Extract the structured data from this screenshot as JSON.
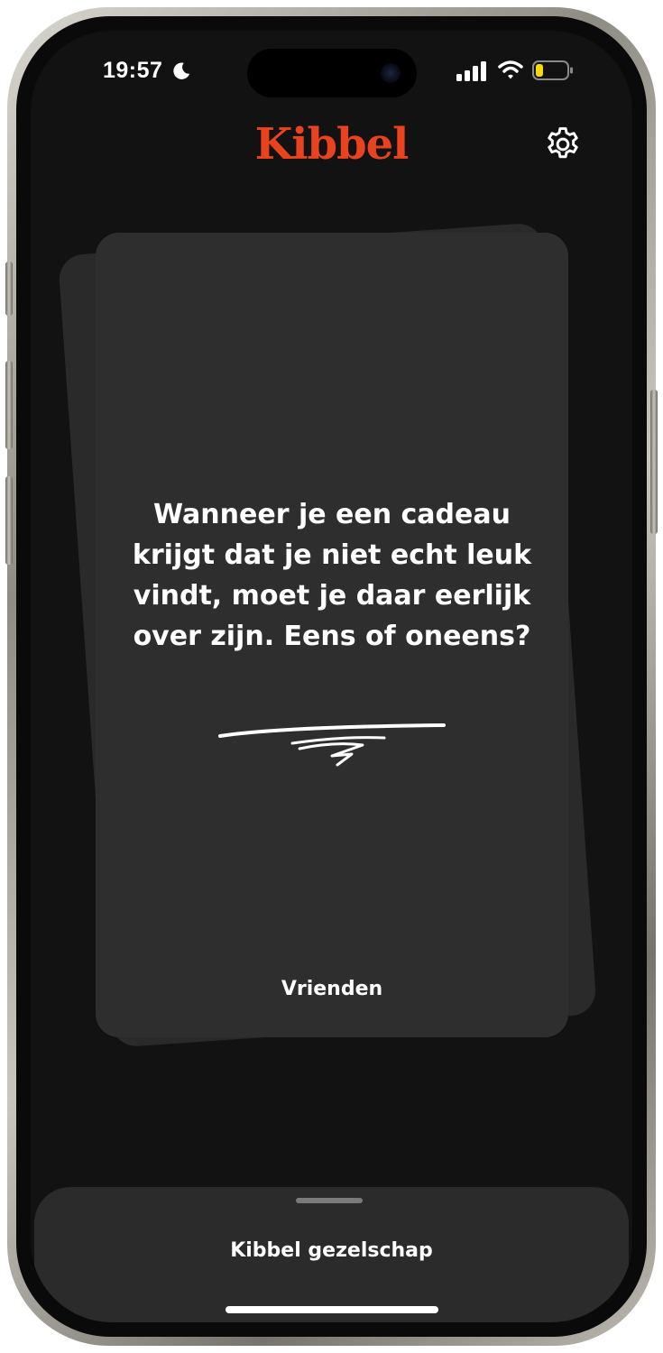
{
  "status_bar": {
    "time": "19:57",
    "icons": [
      "moon-icon",
      "cellular-signal-icon",
      "wifi-icon",
      "battery-icon"
    ],
    "battery_color": "#f5d90a"
  },
  "header": {
    "logo_text": "Kibbel",
    "logo_color": "#e8431e",
    "settings_icon": "gear-icon"
  },
  "card": {
    "question": "Wanneer je een cadeau krijgt dat je niet echt leuk vindt, moet je daar eerlijk over zijn. Eens of oneens?",
    "category": "Vrienden"
  },
  "bottom_sheet": {
    "title": "Kibbel gezelschap"
  }
}
